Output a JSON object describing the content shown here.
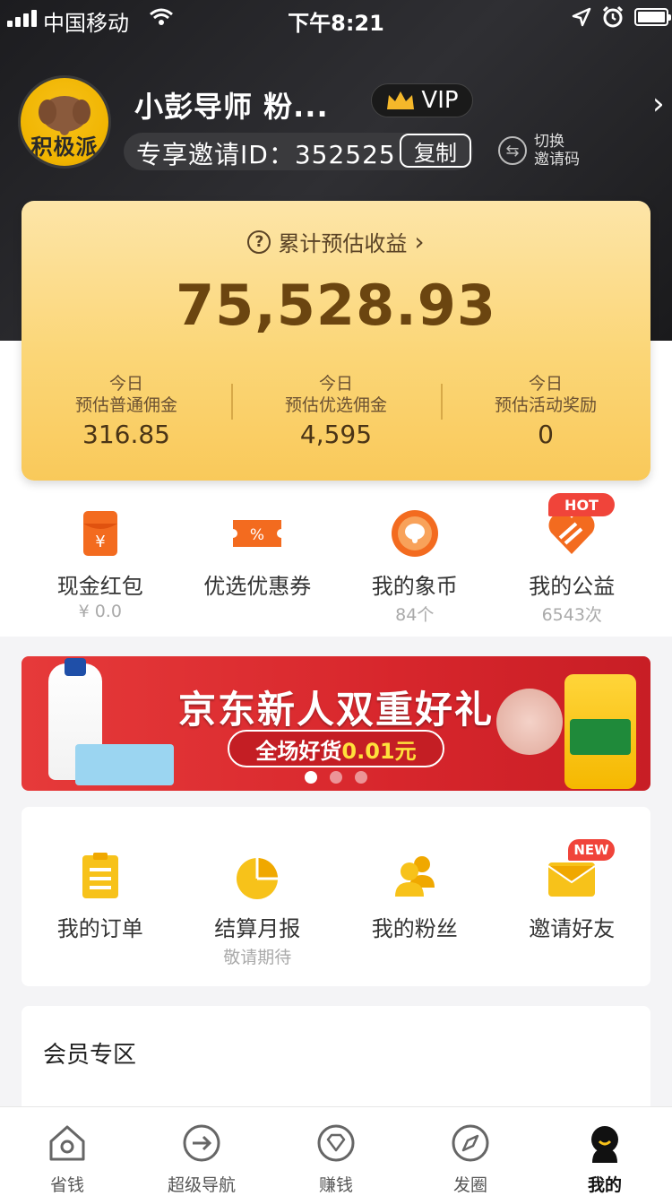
{
  "status_bar": {
    "carrier": "中国移动",
    "time": "下午8:21"
  },
  "profile": {
    "avatar_text": "积极派",
    "username": "小彭导师 粉...",
    "vip_label": "VIP",
    "invite_id_text": "专享邀请ID：352525",
    "copy_label": "复制",
    "switch_label_1": "切换",
    "switch_label_2": "邀请码"
  },
  "earnings": {
    "title": "累计预估收益",
    "amount": "75,528.93",
    "stats": [
      {
        "day": "今日",
        "label": "预估普通佣金",
        "value": "316.85"
      },
      {
        "day": "今日",
        "label": "预估优选佣金",
        "value": "4,595"
      },
      {
        "day": "今日",
        "label": "预估活动奖励",
        "value": "0"
      }
    ]
  },
  "quick": [
    {
      "icon": "red-envelope-icon",
      "label": "现金红包",
      "sub": "¥ 0.0"
    },
    {
      "icon": "coupon-icon",
      "label": "优选优惠券",
      "sub": ""
    },
    {
      "icon": "elephant-coin-icon",
      "label": "我的象币",
      "sub": "84个"
    },
    {
      "icon": "heart-charity-icon",
      "label": "我的公益",
      "sub": "6543次"
    }
  ],
  "hot_tag": "HOT",
  "banner": {
    "title": "京东新人双重好礼",
    "pill_text": "全场好货",
    "pill_price": "0.01元"
  },
  "features": [
    {
      "icon": "order-list-icon",
      "label": "我的订单",
      "sub": ""
    },
    {
      "icon": "pie-chart-icon",
      "label": "结算月报",
      "sub": "敬请期待"
    },
    {
      "icon": "fans-icon",
      "label": "我的粉丝",
      "sub": ""
    },
    {
      "icon": "invite-envelope-icon",
      "label": "邀请好友",
      "sub": ""
    }
  ],
  "new_tag": "NEW",
  "member": {
    "title": "会员专区"
  },
  "tabs": [
    {
      "icon": "home-icon",
      "label": "省钱"
    },
    {
      "icon": "navigation-icon",
      "label": "超级导航"
    },
    {
      "icon": "diamond-icon",
      "label": "赚钱"
    },
    {
      "icon": "compass-icon",
      "label": "发圈"
    },
    {
      "icon": "profile-icon",
      "label": "我的"
    }
  ],
  "colors": {
    "accent_gold": "#f9c95a",
    "brand_red": "#f0443a",
    "dark_header": "#2f2f33"
  }
}
